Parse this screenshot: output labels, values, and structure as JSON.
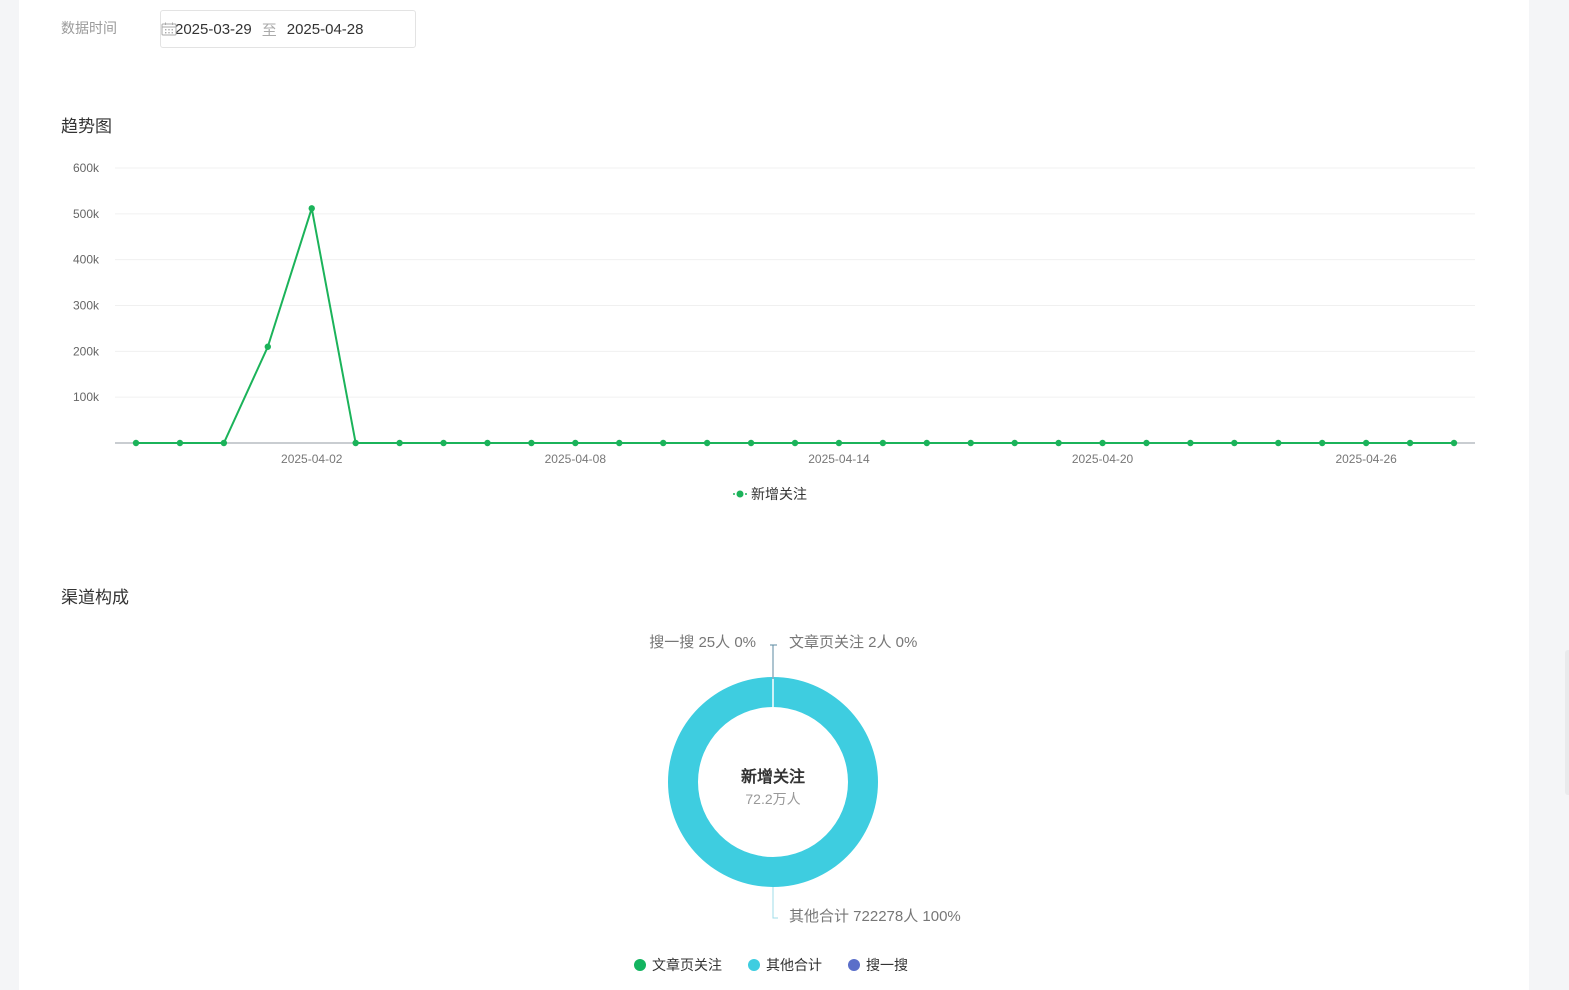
{
  "filter": {
    "label": "数据时间",
    "start_date": "2025-03-29",
    "separator": "至",
    "end_date": "2025-04-28"
  },
  "trend": {
    "title": "趋势图"
  },
  "channel": {
    "title": "渠道构成"
  },
  "chart_data": [
    {
      "type": "line",
      "title": "",
      "x": [
        "2025-03-29",
        "2025-03-30",
        "2025-03-31",
        "2025-04-01",
        "2025-04-02",
        "2025-04-03",
        "2025-04-04",
        "2025-04-05",
        "2025-04-06",
        "2025-04-07",
        "2025-04-08",
        "2025-04-09",
        "2025-04-10",
        "2025-04-11",
        "2025-04-12",
        "2025-04-13",
        "2025-04-14",
        "2025-04-15",
        "2025-04-16",
        "2025-04-17",
        "2025-04-18",
        "2025-04-19",
        "2025-04-20",
        "2025-04-21",
        "2025-04-22",
        "2025-04-23",
        "2025-04-24",
        "2025-04-25",
        "2025-04-26",
        "2025-04-27",
        "2025-04-28"
      ],
      "series": [
        {
          "name": "新增关注",
          "values": [
            0,
            0,
            0,
            210000,
            512000,
            0,
            0,
            0,
            0,
            0,
            0,
            0,
            0,
            0,
            0,
            0,
            0,
            0,
            0,
            0,
            0,
            0,
            0,
            0,
            0,
            0,
            0,
            0,
            0,
            0,
            0
          ]
        }
      ],
      "x_tick_labels": [
        "2025-04-02",
        "2025-04-08",
        "2025-04-14",
        "2025-04-20",
        "2025-04-26"
      ],
      "y_tick_labels": [
        "100k",
        "200k",
        "300k",
        "400k",
        "500k",
        "600k"
      ],
      "ylim": [
        0,
        600000
      ],
      "grid": true,
      "legend": "bottom-center",
      "color": "#1bb35a"
    },
    {
      "type": "pie",
      "title": "",
      "center_title": "新增关注",
      "center_value": "72.2万人",
      "slices": [
        {
          "name": "文章页关注",
          "value": 2,
          "label": "文章页关注 2人 0%",
          "color": "#13b460"
        },
        {
          "name": "其他合计",
          "value": 722278,
          "label": "其他合计 722278人 100%",
          "color": "#3ecde0"
        },
        {
          "name": "搜一搜",
          "value": 25,
          "label": "搜一搜 25人 0%",
          "color": "#5b6fc9"
        }
      ],
      "legend": "bottom-center"
    }
  ]
}
